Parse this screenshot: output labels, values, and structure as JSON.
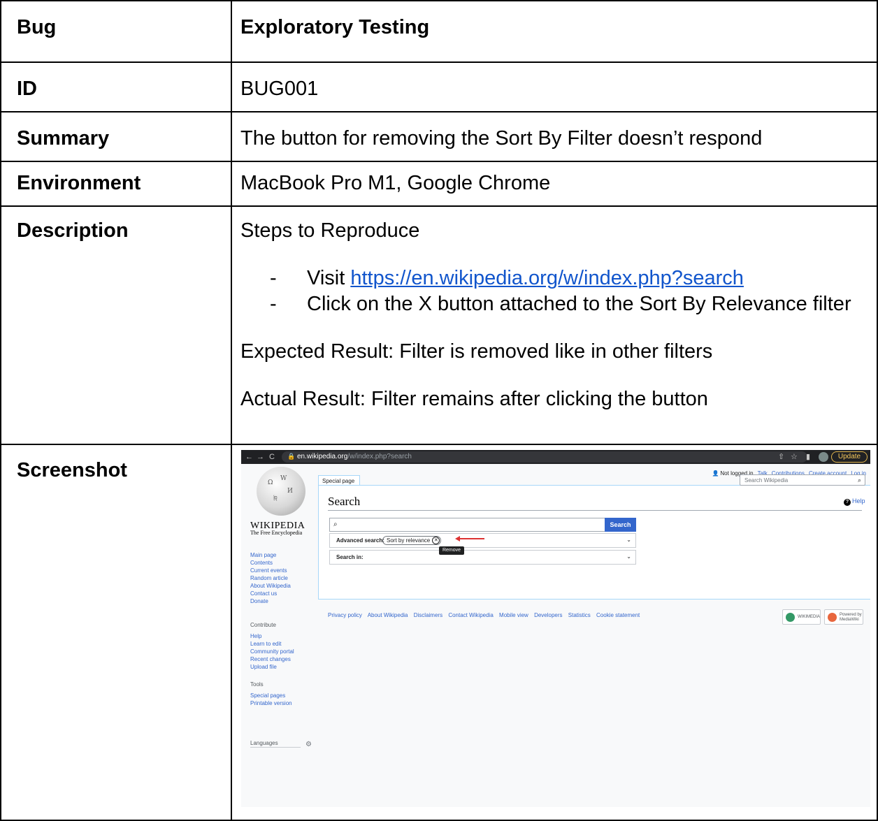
{
  "table": {
    "rows": [
      {
        "label": "Bug",
        "value": "Exploratory Testing"
      },
      {
        "label": "ID",
        "value": "BUG001"
      },
      {
        "label": "Summary",
        "value": "The button for removing the Sort By Filter doesn’t respond"
      },
      {
        "label": "Environment",
        "value": "MacBook Pro M1, Google Chrome"
      },
      {
        "label": "Description"
      },
      {
        "label": "Screenshot"
      }
    ]
  },
  "description": {
    "steps_heading": "Steps to Reproduce",
    "dash": "-",
    "step1_prefix": "Visit ",
    "step1_link": "https://en.wikipedia.org/w/index.php?search",
    "step2": "Click on the X button attached to the Sort By Relevance filter",
    "expected": "Expected Result: Filter is removed like in other filters",
    "actual": "Actual Result: Filter remains after clicking the button"
  },
  "screenshot": {
    "browser": {
      "url_domain": "en.wikipedia.org",
      "url_path": "/w/index.php?search",
      "update_label": "Update",
      "back_icon": "←",
      "forward_icon": "→",
      "reload_icon": "C"
    },
    "user_links": {
      "not_logged_in": "Not logged in",
      "talk": "Talk",
      "contributions": "Contributions",
      "create_account": "Create account",
      "log_in": "Log in"
    },
    "logo": {
      "wordmark": "WIKIPEDIA",
      "tagline": "The Free Encyclopedia"
    },
    "sidebar": {
      "nav": [
        "Main page",
        "Contents",
        "Current events",
        "Random article",
        "About Wikipedia",
        "Contact us",
        "Donate"
      ],
      "contribute_heading": "Contribute",
      "contribute": [
        "Help",
        "Learn to edit",
        "Community portal",
        "Recent changes",
        "Upload file"
      ],
      "tools_heading": "Tools",
      "tools": [
        "Special pages",
        "Printable version"
      ],
      "languages_heading": "Languages"
    },
    "tab_label": "Special page",
    "search_wiki_placeholder": "Search Wikipedia",
    "page_title": "Search",
    "help_label": "Help",
    "search_button": "Search",
    "advanced_search_label": "Advanced search:",
    "chip_label": "Sort by relevance",
    "tooltip": "Remove",
    "search_in_label": "Search in:",
    "footer": [
      "Privacy policy",
      "About Wikipedia",
      "Disclaimers",
      "Contact Wikipedia",
      "Mobile view",
      "Developers",
      "Statistics",
      "Cookie statement"
    ],
    "badges": {
      "wikimedia": "WIKIMEDIA",
      "mediawiki": "Powered by MediaWiki"
    },
    "colors": {
      "link": "#3366cc",
      "accent_button": "#3366cc",
      "arrow": "#dd3333",
      "doc_link": "#1155cc"
    }
  }
}
